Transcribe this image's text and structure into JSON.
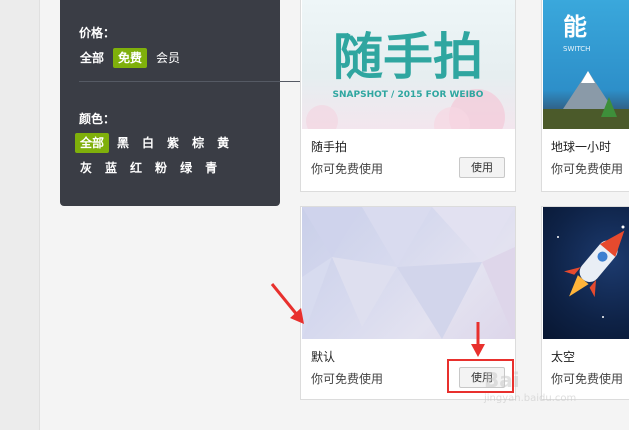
{
  "filters": {
    "price": {
      "title": "价格：",
      "options": [
        "全部",
        "免费",
        "会员"
      ],
      "active": "免费"
    },
    "color": {
      "title": "颜色：",
      "row1": [
        "全部",
        "黑",
        "白",
        "紫",
        "棕",
        "黄"
      ],
      "row2": [
        "灰",
        "蓝",
        "红",
        "粉",
        "绿",
        "青"
      ],
      "active": "全部"
    }
  },
  "skins": [
    {
      "name": "随手拍",
      "note": "你可免费使用",
      "button": "使用",
      "art_title": "随手拍",
      "art_subtitle": "SNAPSHOT / 2015 FOR WEIBO"
    },
    {
      "name": "地球一小时",
      "note": "你可免费使用",
      "art_title": "能",
      "art_subtitle": "SWITCH"
    },
    {
      "name": "默认",
      "note": "你可免费使用",
      "button": "使用"
    },
    {
      "name": "太空",
      "note": "你可免费使用"
    }
  ],
  "watermark": {
    "text": "Bai",
    "sub": "jingyan.baidu.com"
  },
  "colors": {
    "accent": "#7fb00b",
    "panel": "#3a3d45",
    "annotation": "#e8302d"
  }
}
